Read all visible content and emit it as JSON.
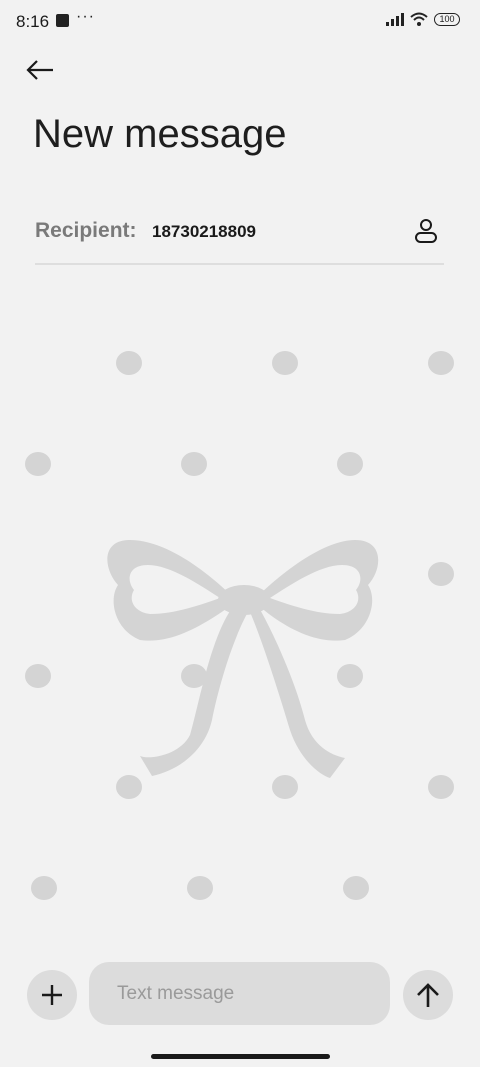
{
  "status_bar": {
    "time": "8:16",
    "dots": "···",
    "battery": "100",
    "icons": [
      "app-notification-icon",
      "signal-icon",
      "wifi-icon",
      "battery-icon"
    ]
  },
  "header": {
    "back_icon": "back-arrow-icon",
    "title": "New message"
  },
  "recipient": {
    "label": "Recipient:",
    "value": "18730218809",
    "contact_icon": "contact-person-icon"
  },
  "wallpaper": {
    "motif": [
      "dot-pattern",
      "bow-ribbon"
    ],
    "color": "#d4d4d4"
  },
  "composer": {
    "add_icon": "plus-icon",
    "placeholder": "Text message",
    "send_icon": "send-arrow-up-icon"
  },
  "colors": {
    "background": "#f2f2f2",
    "control_fill": "#dcdcdc",
    "accent_text": "#1a1a1a",
    "label_gray": "#7a7a7a"
  }
}
